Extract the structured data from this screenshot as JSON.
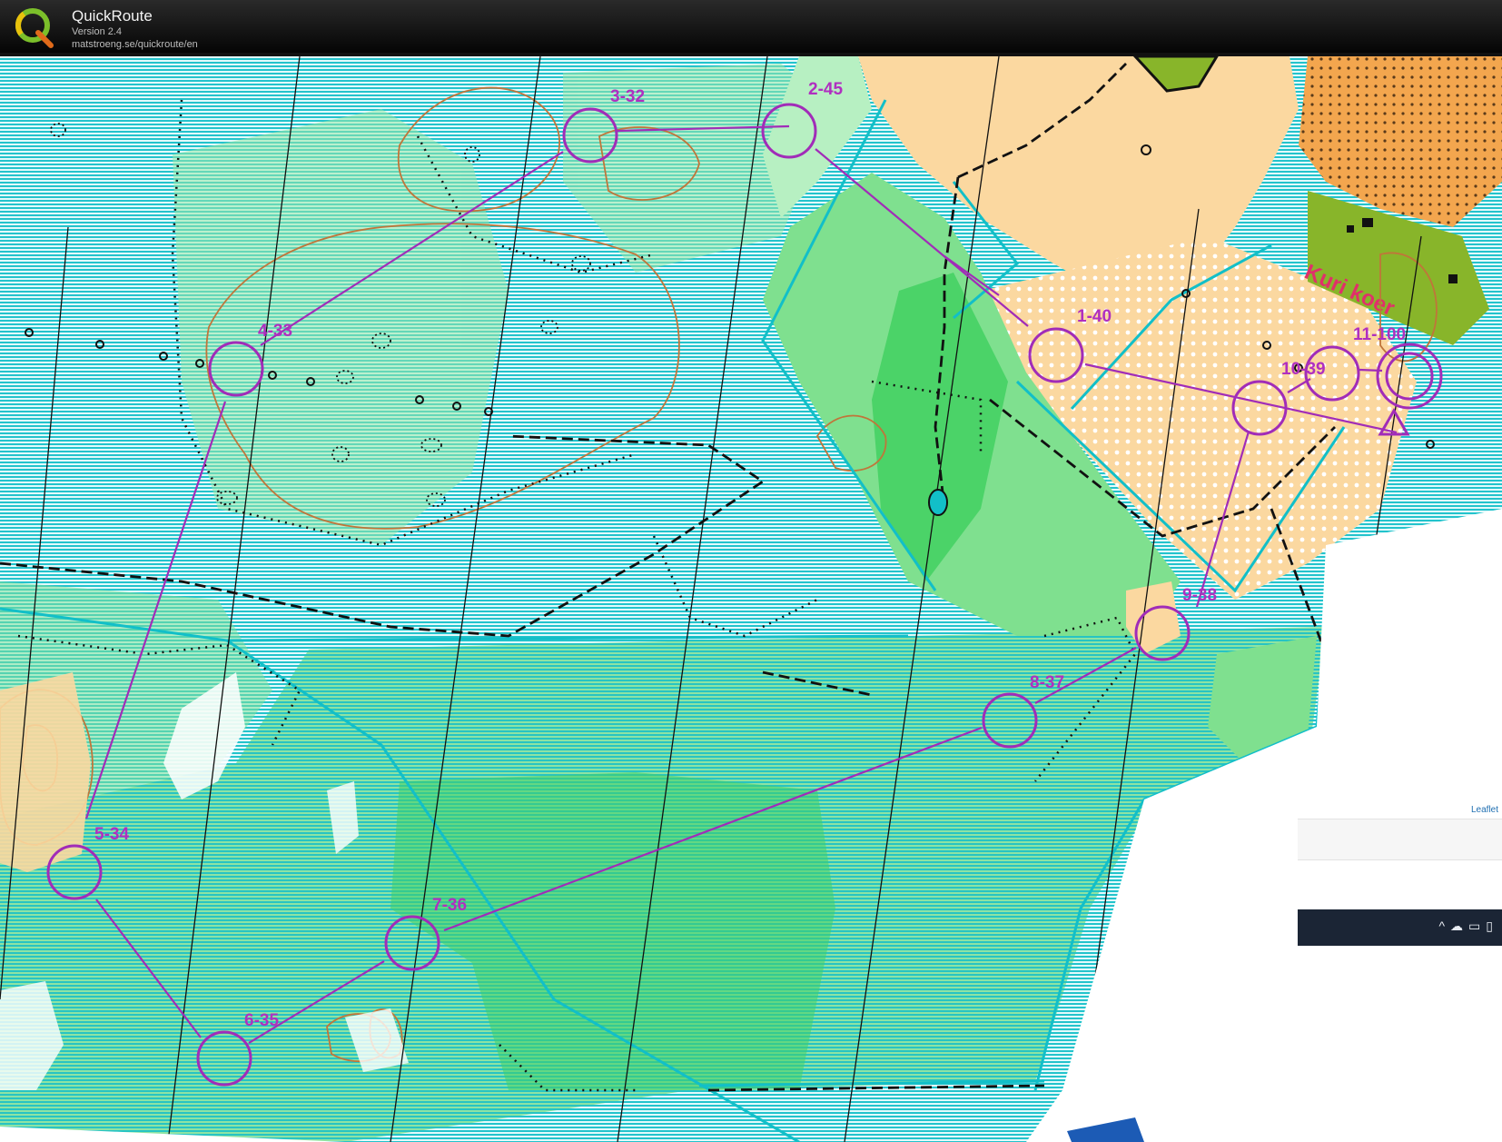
{
  "app": {
    "title": "QuickRoute",
    "version": "Version 2.4",
    "url": "matstroeng.se/quickroute/en",
    "logo_letter": "Q"
  },
  "map": {
    "area_label": "Kuri koer",
    "attribution": "Leaflet",
    "colors": {
      "marsh": "#12bfc8",
      "open_land": "#fbd8a0",
      "green": "#77df8a",
      "dark_green": "#3fcf5e",
      "olive": "#88b52a",
      "course": "#a12cb8",
      "contour": "#c0753a"
    }
  },
  "controls": [
    {
      "label": "1-40"
    },
    {
      "label": "2-45"
    },
    {
      "label": "3-32"
    },
    {
      "label": "4-33"
    },
    {
      "label": "5-34"
    },
    {
      "label": "6-35"
    },
    {
      "label": "7-36"
    },
    {
      "label": "8-37"
    },
    {
      "label": "9-38"
    },
    {
      "label": "10-39"
    },
    {
      "label": "11-100"
    }
  ],
  "taskbar": {
    "tray_icons": [
      "chevron-up-icon",
      "cloud-icon",
      "battery-icon",
      "display-icon"
    ]
  }
}
